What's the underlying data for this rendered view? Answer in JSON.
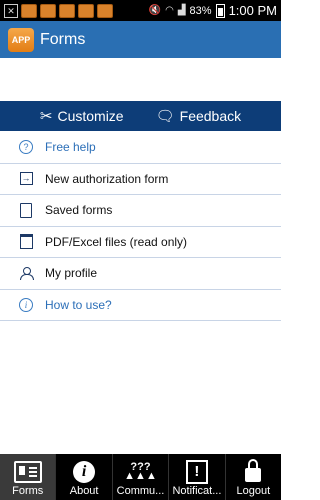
{
  "status_bar": {
    "battery": "83%",
    "time": "1:00 PM"
  },
  "app_bar": {
    "icon_text": "APP",
    "title": "Forms"
  },
  "actions": {
    "customize": "Customize",
    "feedback": "Feedback"
  },
  "menu": [
    {
      "label": "Free help",
      "icon": "help-circle-icon",
      "style": "link"
    },
    {
      "label": "New authorization form",
      "icon": "arrow-right-box-icon",
      "style": "normal"
    },
    {
      "label": "Saved forms",
      "icon": "document-icon",
      "style": "normal"
    },
    {
      "label": "PDF/Excel files (read only)",
      "icon": "pdf-file-icon",
      "style": "normal"
    },
    {
      "label": "My profile",
      "icon": "person-icon",
      "style": "normal"
    },
    {
      "label": "How to use?",
      "icon": "info-circle-icon",
      "style": "link"
    }
  ],
  "bottom_nav": [
    {
      "label": "Forms",
      "icon": "forms-icon",
      "active": true
    },
    {
      "label": "About",
      "icon": "info-icon",
      "active": false
    },
    {
      "label": "Commu...",
      "icon": "community-icon",
      "active": false
    },
    {
      "label": "Notificat...",
      "icon": "notification-icon",
      "active": false
    },
    {
      "label": "Logout",
      "icon": "lock-icon",
      "active": false
    }
  ],
  "colors": {
    "app_bar": "#2a6fb3",
    "action_bar": "#0d3d78",
    "link_text": "#2c6fb8",
    "divider": "#c8d4e6"
  }
}
